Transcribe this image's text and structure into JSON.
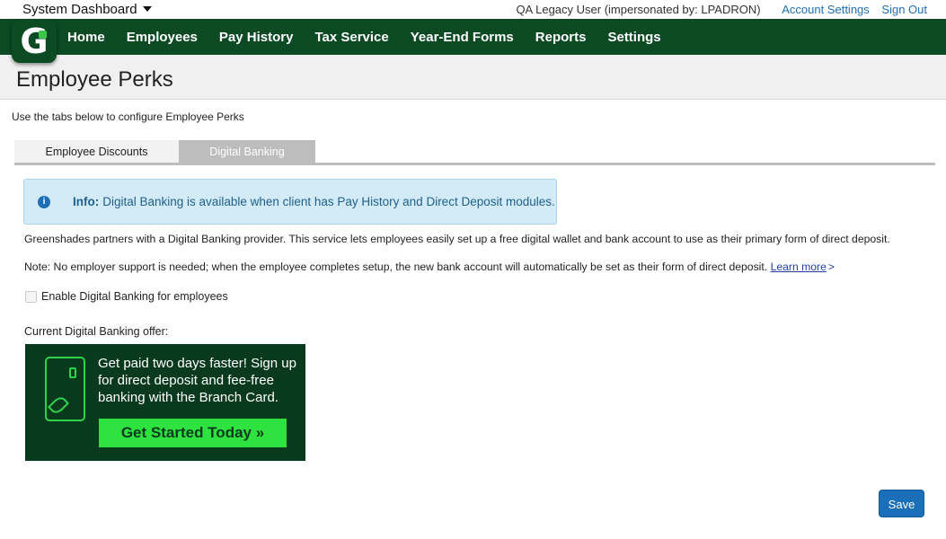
{
  "topbar": {
    "dashboard_label": "System Dashboard",
    "user_label": "QA Legacy User (impersonated by: LPADRON)",
    "account_settings": "Account Settings",
    "sign_out": "Sign Out"
  },
  "nav": {
    "logo_letter": "G",
    "items": [
      "Home",
      "Employees",
      "Pay History",
      "Tax Service",
      "Year-End Forms",
      "Reports",
      "Settings"
    ]
  },
  "page": {
    "title": "Employee Perks",
    "instruction": "Use the tabs below to configure Employee Perks"
  },
  "tabs": [
    {
      "label": "Employee Discounts",
      "active": false
    },
    {
      "label": "Digital Banking",
      "active": true
    }
  ],
  "info": {
    "icon": "info-icon",
    "label": "Info:",
    "text": "Digital Banking is available when client has Pay History and Direct Deposit modules."
  },
  "content": {
    "description": "Greenshades partners with a Digital Banking provider. This service lets employees easily set up a free digital wallet and bank account to use as their primary form of direct deposit.",
    "note": "Note: No employer support is needed; when the employee completes setup, the new bank account will automatically be set as their form of direct deposit.",
    "learn_more": "Learn more",
    "learn_more_arrow": ">",
    "checkbox_label": "Enable Digital Banking for employees",
    "checkbox_checked": false,
    "offer_label": "Current Digital Banking offer:"
  },
  "promo": {
    "text": "Get paid two days faster! Sign up for direct deposit and fee-free banking with the Branch Card.",
    "button": "Get Started Today »"
  },
  "actions": {
    "save": "Save"
  },
  "colors": {
    "nav_bg": "#0b4a23",
    "link": "#1f6fb5",
    "info_bg": "#d3ebf7",
    "promo_bg": "#0a3a1e",
    "promo_accent": "#2ee33f",
    "save_bg": "#1a6fb8"
  }
}
